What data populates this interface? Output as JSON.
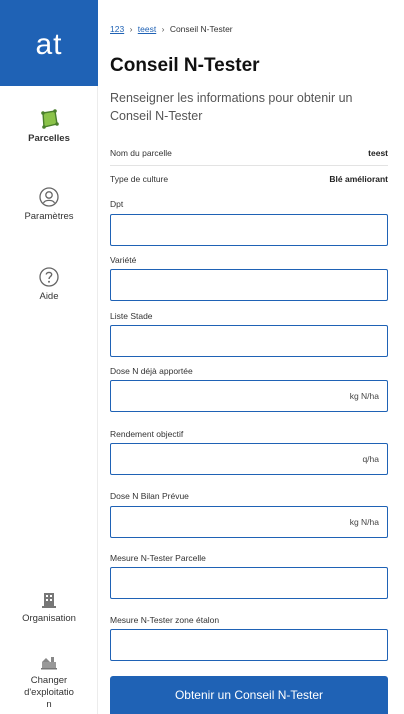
{
  "sidebar": {
    "logo": "at",
    "items": [
      {
        "label": "Parcelles",
        "icon": "field-plot-icon",
        "active": true
      },
      {
        "label": "Paramètres",
        "icon": "user-settings-icon",
        "active": false
      },
      {
        "label": "Aide",
        "icon": "help-icon",
        "active": false
      },
      {
        "label": "Organisation",
        "icon": "building-icon",
        "active": false
      },
      {
        "label": "Changer d'exploitation",
        "line1": "Changer",
        "line2": "d'exploitatio",
        "line3": "n",
        "icon": "farm-switch-icon",
        "active": false
      }
    ]
  },
  "breadcrumb": {
    "item1": "123",
    "item2": "teest",
    "current": "Conseil N-Tester",
    "separator": "›"
  },
  "page": {
    "title": "Conseil N-Tester",
    "subtitle": "Renseigner les informations pour obtenir un Conseil N-Tester"
  },
  "info": {
    "parcel_label": "Nom du parcelle",
    "parcel_value": "teest",
    "culture_label": "Type de culture",
    "culture_value": "Blé améliorant"
  },
  "form": {
    "fields": [
      {
        "label": "Dpt",
        "value": "",
        "unit": ""
      },
      {
        "label": "Variété",
        "value": "",
        "unit": ""
      },
      {
        "label": "Liste Stade",
        "value": "",
        "unit": ""
      },
      {
        "label": "Dose N déjà apportée",
        "value": "",
        "unit": "kg N/ha"
      },
      {
        "label": "Rendement objectif",
        "value": "",
        "unit": "q/ha"
      },
      {
        "label": "Dose N Bilan Prévue",
        "value": "",
        "unit": "kg N/ha"
      },
      {
        "label": "Mesure N-Tester Parcelle",
        "value": "",
        "unit": ""
      },
      {
        "label": "Mesure N-Tester zone étalon",
        "value": "",
        "unit": ""
      }
    ],
    "submit_label": "Obtenir un Conseil N-Tester"
  },
  "colors": {
    "primary": "#1f62b5",
    "field_icon": "#6ab04c"
  }
}
